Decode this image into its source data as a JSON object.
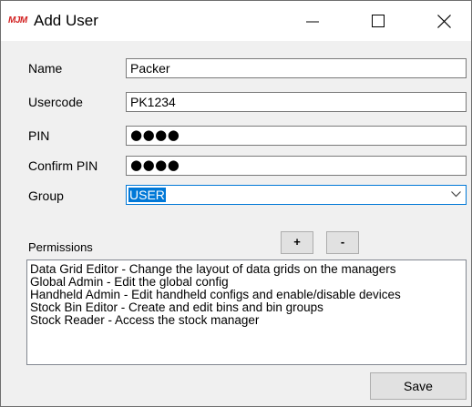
{
  "window": {
    "logo_text": "MJM",
    "title": "Add User",
    "controls": {
      "minimize_icon": "minimize-icon",
      "maximize_icon": "maximize-icon",
      "close_icon": "close-icon"
    }
  },
  "form": {
    "name_label": "Name",
    "name_value": "Packer",
    "usercode_label": "Usercode",
    "usercode_value": "PK1234",
    "pin_label": "PIN",
    "pin_value": "●●●●",
    "confirm_pin_label": "Confirm PIN",
    "confirm_pin_value": "●●●●",
    "group_label": "Group",
    "group_value": "USER"
  },
  "permissions": {
    "label": "Permissions",
    "add_label": "+",
    "remove_label": "-",
    "items": [
      "Data Grid Editor - Change the layout of data grids on the managers",
      "Global Admin - Edit the global config",
      "Handheld Admin - Edit handheld configs and enable/disable devices",
      "Stock Bin Editor - Create and edit bins and bin groups",
      "Stock Reader - Access the stock manager"
    ]
  },
  "footer": {
    "save_label": "Save"
  },
  "colors": {
    "selection": "#0078d7",
    "logo": "#d22020",
    "window_bg": "#f0f0f0"
  }
}
